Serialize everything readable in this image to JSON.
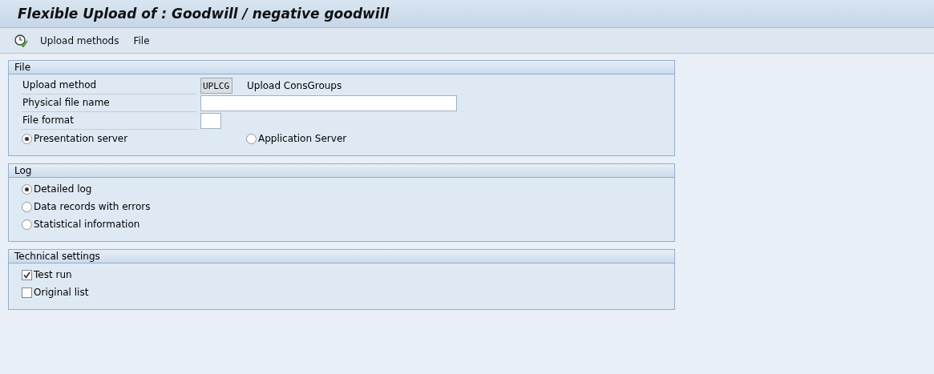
{
  "window": {
    "title": "Flexible Upload of : Goodwill / negative goodwill"
  },
  "toolbar": {
    "items": [
      {
        "kind": "icon"
      },
      {
        "kind": "menu",
        "label": "Upload methods"
      },
      {
        "kind": "menu",
        "label": "File"
      }
    ]
  },
  "sections": [
    {
      "title": "File",
      "rows": [
        {
          "kind": "field",
          "label": "Upload method",
          "input": {
            "kind": "code",
            "value": "UPLCG"
          },
          "description": "Upload ConsGroups"
        },
        {
          "kind": "field",
          "label": "Physical file name",
          "input": {
            "kind": "long"
          }
        },
        {
          "kind": "field",
          "label": "File format",
          "input": {
            "kind": "short"
          }
        },
        {
          "kind": "radio-pair",
          "options": [
            {
              "label": "Presentation server",
              "selected": true
            },
            {
              "label": "Application Server",
              "selected": false
            }
          ]
        }
      ]
    },
    {
      "title": "Log",
      "rows": [
        {
          "kind": "radio",
          "label": "Detailed log",
          "selected": true
        },
        {
          "kind": "radio",
          "label": "Data records with errors",
          "selected": false
        },
        {
          "kind": "radio",
          "label": "Statistical information",
          "selected": false
        }
      ]
    },
    {
      "title": "Technical settings",
      "rows": [
        {
          "kind": "checkbox",
          "label": "Test run",
          "checked": true
        },
        {
          "kind": "checkbox",
          "label": "Original list",
          "checked": false
        }
      ]
    }
  ]
}
